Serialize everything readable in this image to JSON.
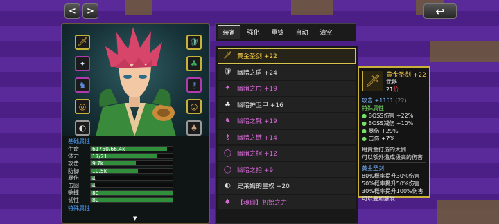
{
  "nav": {
    "back_label": "<",
    "forward_label": ">",
    "return_label": "↩"
  },
  "equipment_slots": {
    "left": [
      "sword-icon",
      "gem-icon",
      "armor-icon",
      "ring-icon",
      "amulet-icon"
    ],
    "right": [
      "shield-icon",
      "crown-icon",
      "boots-icon",
      "ring-icon",
      "bag-icon"
    ]
  },
  "stats": {
    "title": "基础属性",
    "footer": "特殊属性",
    "rows": [
      {
        "label": "生命",
        "value": "61750/66.4k",
        "fill": 0.93
      },
      {
        "label": "体力",
        "value": "17/21",
        "fill": 0.81
      },
      {
        "label": "攻击",
        "value": "9.7k",
        "fill": 0.55
      },
      {
        "label": "防御",
        "value": "10.5k",
        "fill": 0.58
      },
      {
        "label": "暴伤",
        "value": "4",
        "fill": 0.03
      },
      {
        "label": "击回",
        "value": "4",
        "fill": 0.03
      },
      {
        "label": "敏捷",
        "value": "80",
        "fill": 1.0
      },
      {
        "label": "韧性",
        "value": "80",
        "fill": 1.0
      }
    ]
  },
  "tabs": [
    "装备",
    "强化",
    "重铸",
    "自动",
    "清空"
  ],
  "items": [
    {
      "name": "黄金圣剑 +22",
      "color": "#ffd24a",
      "icon": "🗡",
      "selected": true
    },
    {
      "name": "幽暗之盾 +24",
      "color": "#e6e6e6",
      "icon": "🛡",
      "selected": false
    },
    {
      "name": "幽暗之巾 +19",
      "color": "#d86ad8",
      "icon": "✦",
      "selected": false
    },
    {
      "name": "幽暗护卫甲 +16",
      "color": "#e6e6e6",
      "icon": "♣",
      "selected": false
    },
    {
      "name": "幽暗之靴 +19",
      "color": "#d86ad8",
      "icon": "♞",
      "selected": false
    },
    {
      "name": "幽暗之链 +14",
      "color": "#d86ad8",
      "icon": "⚷",
      "selected": false
    },
    {
      "name": "幽暗之指 +12",
      "color": "#d86ad8",
      "icon": "◯",
      "selected": false
    },
    {
      "name": "幽暗之指 +9",
      "color": "#d86ad8",
      "icon": "◯",
      "selected": false
    },
    {
      "name": "史莱姆的皇权 +20",
      "color": "#e6e6e6",
      "icon": "◐",
      "selected": false
    },
    {
      "name": "【魂印】初始之力",
      "color": "#d86ad8",
      "icon": "♠",
      "selected": false
    }
  ],
  "tooltip": {
    "name": "黄金圣剑 +22",
    "type": "武器",
    "level": "21",
    "level_suffix": "阶",
    "attack": "攻击 +1151",
    "attack_note": "(22)",
    "special_title": "特殊属性",
    "special": [
      "BOSS伤害 +22%",
      "BOSS减伤 +10%",
      "暴伤 +29%",
      "击伤 +7%"
    ],
    "desc1": "用黄金打造的大剑",
    "desc2": "可以额外造成极高的伤害",
    "set_title": "黄金圣剑",
    "set_lines": [
      "80%概率提升30%伤害",
      "50%概率提升50%伤害",
      "30%概率提升100%伤害",
      "可以叠加触发"
    ]
  }
}
